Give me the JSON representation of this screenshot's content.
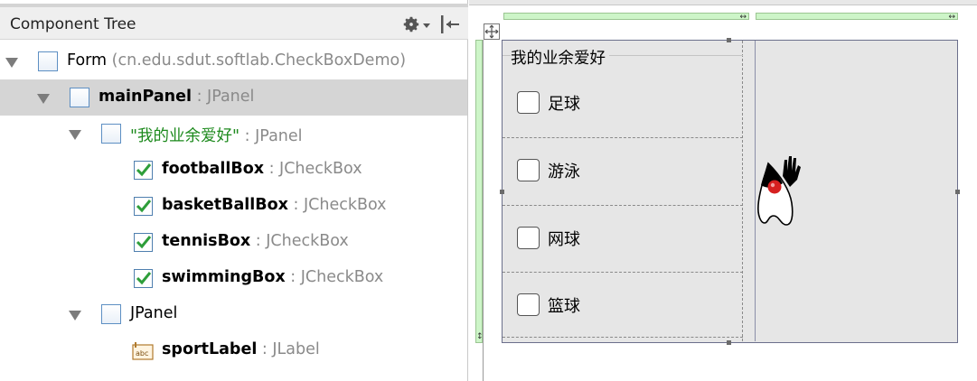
{
  "component_tree": {
    "title": "Component Tree",
    "toolbar_icons": [
      "gear-icon",
      "chevron-down-icon",
      "collapse-all-icon"
    ],
    "nodes": [
      {
        "name": "Form",
        "type": "(cn.edu.sdut.softlab.CheckBoxDemo)",
        "icon": "form-icon",
        "expanded": true
      },
      {
        "name": "mainPanel",
        "type": "JPanel",
        "icon": "panel-icon",
        "expanded": true,
        "selected": true
      },
      {
        "name": "\"我的业余爱好\"",
        "type": "JPanel",
        "icon": "panel-icon",
        "expanded": true
      },
      {
        "name": "footballBox",
        "type": "JCheckBox",
        "icon": "checkbox-icon"
      },
      {
        "name": "basketBallBox",
        "type": "JCheckBox",
        "icon": "checkbox-icon"
      },
      {
        "name": "tennisBox",
        "type": "JCheckBox",
        "icon": "checkbox-icon"
      },
      {
        "name": "swimmingBox",
        "type": "JCheckBox",
        "icon": "checkbox-icon"
      },
      {
        "name": "JPanel",
        "type": "",
        "icon": "panel-icon",
        "expanded": true
      },
      {
        "name": "sportLabel",
        "type": "JLabel",
        "icon": "label-icon"
      }
    ],
    "separator": " : "
  },
  "designer": {
    "hobby_panel_title": "我的业余爱好",
    "checkboxes": [
      {
        "label": "足球",
        "checked": false
      },
      {
        "label": "游泳",
        "checked": false
      },
      {
        "label": "网球",
        "checked": false
      },
      {
        "label": "篮球",
        "checked": false
      }
    ],
    "sport_label_icon": "duke-mascot-icon",
    "guide_glyph": "↔",
    "guide_glyph_vertical": "↕"
  },
  "colors": {
    "selection": "#d5d5d5",
    "green_text": "#1d8a1d",
    "type_text": "#8a8a8a",
    "guide_green": "#cdf5c8",
    "panel_border": "#6b6f8c",
    "checkbox_check": "#2e9e3a"
  }
}
